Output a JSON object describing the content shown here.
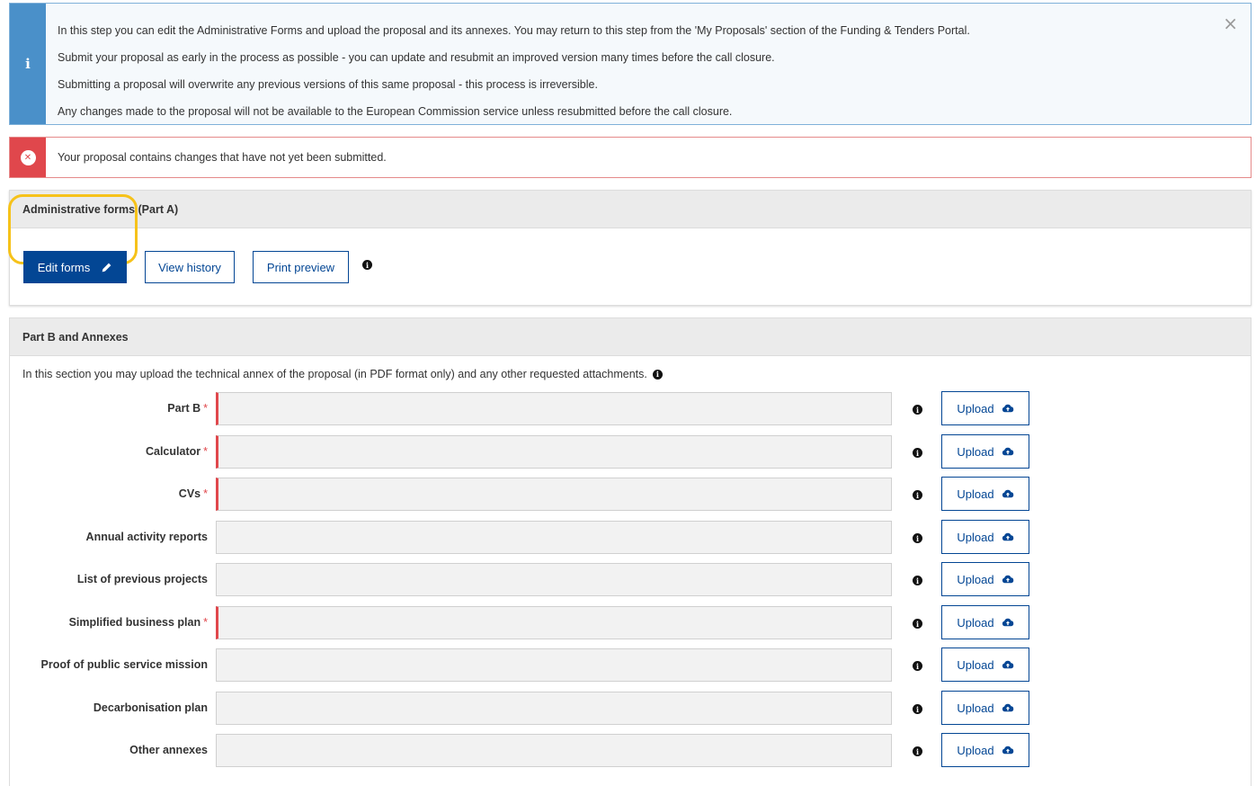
{
  "info_alert": {
    "icon": "info-icon",
    "lines": [
      "In this step you can edit the Administrative Forms and upload the proposal and its annexes. You may return to this step from the 'My Proposals' section of the Funding & Tenders Portal.",
      "Submit your proposal as early in the process as possible - you can update and resubmit an improved version many times before the call closure.",
      "Submitting a proposal will overwrite any previous versions of this same proposal - this process is irreversible.",
      "Any changes made to the proposal will not be available to the European Commission service unless resubmitted before the call closure."
    ],
    "close_label": "×"
  },
  "error_alert": {
    "icon": "error-circle-icon",
    "text": "Your proposal contains changes that have not yet been submitted."
  },
  "part_a": {
    "title": "Administrative forms (Part A)",
    "edit_label": "Edit forms",
    "history_label": "View history",
    "print_label": "Print preview"
  },
  "part_b": {
    "title": "Part B and Annexes",
    "intro": "In this section you may upload the technical annex of the proposal (in PDF format only) and any other requested attachments.",
    "upload_label": "Upload",
    "rows": [
      {
        "label": "Part B",
        "required": true
      },
      {
        "label": "Calculator",
        "required": true
      },
      {
        "label": "CVs",
        "required": true
      },
      {
        "label": "Annual activity reports",
        "required": false
      },
      {
        "label": "List of previous projects",
        "required": false
      },
      {
        "label": "Simplified business plan",
        "required": true
      },
      {
        "label": "Proof of public service mission",
        "required": false
      },
      {
        "label": "Decarbonisation plan",
        "required": false
      },
      {
        "label": "Other annexes",
        "required": false
      }
    ]
  },
  "colors": {
    "primary": "#034694",
    "info": "#4a90c9",
    "error": "#e0474c",
    "highlight": "#f6c21a"
  }
}
